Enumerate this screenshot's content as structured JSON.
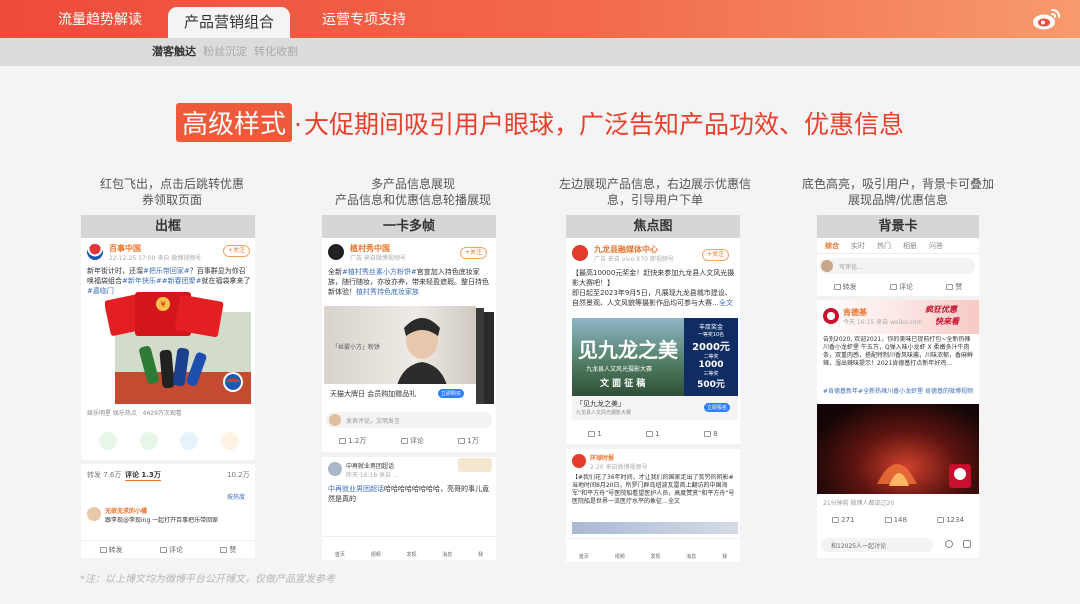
{
  "nav": {
    "tabs": [
      {
        "label": "流量趋势解读"
      },
      {
        "label": "产品营销组合"
      },
      {
        "label": "运营专项支持"
      }
    ],
    "subtabs": [
      {
        "label": "潜客触达"
      },
      {
        "label": "粉丝沉淀"
      },
      {
        "label": "转化收割"
      }
    ]
  },
  "headline": {
    "badge": "高级样式",
    "dot": "·",
    "text": "大促期间吸引用户眼球，广泛告知产品功效、优惠信息"
  },
  "columns": [
    {
      "desc1": "红包飞出，点击后跳转优惠",
      "desc2": "券领取页面",
      "title": "出框",
      "post": {
        "name": "百事中国",
        "meta": "22-12-25 17:00  来自 微博视频号",
        "follow": "+关注",
        "text_a": "新年街计时，还溜",
        "tag1": "#把乐带回家#",
        "text_b": "？百事群显为你召唤福袋组合",
        "tag2": "#新年快乐#",
        "tag3": "#新春团聚#",
        "text_c": "就在福袋拿来了",
        "tag4": "#嘉临门",
        "footer": "娱乐明星 娱乐热点 · 4629万次观看",
        "stats_repost": "转发 7.6万",
        "stats_comment": "评论 1.3万",
        "stats_like": "10.2万",
        "reply_sort": "按热度",
        "reply_name": "无欲无求的小橘",
        "reply_text": "跟李现@李现ing 一起打开百事把乐带回家",
        "actions": {
          "repost": "转发",
          "comment": "评论",
          "like": "赞"
        }
      }
    },
    {
      "desc1": "多产品信息展现",
      "desc2": "产品信息和优惠信息轮播展现",
      "title": "一卡多帧",
      "post": {
        "name": "植村秀中国",
        "meta": "广告  来自微博视频号",
        "follow": "+关注",
        "text_a": "全新",
        "tag1": "#植村秀丝素小方粉饼#",
        "text_b": "官宣加入持色底妆家族，随行随妆，亦妆亦养，带来轻盈遮瑕。整日持色新体验！",
        "tag2": "植村秀持色底妆家族",
        "slide_sub": "「丝雾小方」粉饼",
        "slide_caption": "天猫大牌日 会员购加赠品礼",
        "slide_btn": "立即购买",
        "comment_ph": "发表评论，文明发言",
        "actions": {
          "repost": "1.2万",
          "comment": "评论",
          "like": "1万"
        },
        "post2_name": "中再就业男团超话",
        "post2_meta": "昨天 16:18  来自 ...",
        "post2_text_a": "中再就业男团超话",
        "post2_text_b": "哈哈哈哈哈哈哈哈，亮哥的事儿竟然是真的",
        "bottom_nav": [
          "首页",
          "视频",
          "发现",
          "消息",
          "我"
        ]
      }
    },
    {
      "desc1": "左边展现产品信息，右边展示优惠信",
      "desc2": "息，引导用户下单",
      "title": "焦点图",
      "post": {
        "name": "九龙县融媒体中心",
        "meta": "广告  来自 vivo X70 即视频号",
        "follow": "+关注",
        "text_a": "【",
        "tag1": "最高10000元奖金",
        "text_b": "！赶快来参加九龙县人文风光摄影大赛吧！】\n即日起至2023年9月5日，凡展现九龙县城市建设、自然景观、人文风貌等摄影作品均可参与大赛…",
        "tag2": "全文",
        "img_big": "见九龙之美",
        "img_sub1": "九龙县人文风光摄影大赛",
        "img_sub2": "文 面 征 稿",
        "prize_title": "丰厚奖金",
        "prize_rank1": "一等奖10名",
        "prize1": "2000元",
        "prize_rank2": "二等奖",
        "prize2": "1000",
        "prize_rank3": "三等奖",
        "prize3": "500元",
        "card_title": "「见九龙之美」",
        "card_sub": "九龙县人文风光摄影大赛",
        "card_btn": "立即报名",
        "actions": {
          "repost": "1",
          "comment": "1",
          "like": "8"
        },
        "post2_name": "环球时报",
        "post2_meta": "2-20 来自微博视频号",
        "post2_text": "【#我们花了36年时间，才让我们的国家走出了贫穷的阴影# 当地时间8月20日，所罗门群岛纽波瓦雷首上翻访的中国海军“和平方舟”号医院船看望医护人员，高度赞赏“和平方舟”号医院船是世界一流医疗水平的象征…全文",
        "bottom_nav": [
          "首页",
          "视频",
          "发现",
          "消息",
          "我"
        ]
      }
    },
    {
      "desc1": "底色高亮，吸引用户，背景卡可叠加",
      "desc2": "展现品牌/优惠信息",
      "title": "背景卡",
      "post": {
        "tabs": [
          "综合",
          "实时",
          "热门",
          "相册",
          "问答"
        ],
        "comment_ph": "写评论...",
        "top_actions": {
          "repost": "转发",
          "comment": "评论",
          "like": "赞"
        },
        "name": "肯德基",
        "meta": "今天 16:15  来自 weibo.com",
        "bg_text1": "疯狂优惠",
        "bg_text2": "快来看",
        "text": "告别2020, 欢迎2021，你的美味已提前打包~全新热辣川香小龙虾堡 牛五万，Q弹入味小龙虾 X 柔嫩多汁牛肉条，双重肉感，搭配特制川香风味酱，川味浓郁，香麻鲜辣，湿出辣味提示！2021肯德基打点新年好鸡...",
        "tag1": "#肯德基新年#",
        "tag2": "全新热辣川香小龙虾堡",
        "tag3": "肯德基的微博视频",
        "video_meta": "21分钟前 微博人都说过20",
        "actions": {
          "repost": "271",
          "comment": "148",
          "like": "1234"
        },
        "discuss": "和12025人一起讨论"
      }
    }
  ],
  "footnote": "*注：以上博文均为微博平台公开博文，仅做产品宣发参考",
  "colors": {
    "brand": "#ef4a3b",
    "headline": "#e7402c",
    "link": "#3f6fb8",
    "name": "#e8742d"
  }
}
